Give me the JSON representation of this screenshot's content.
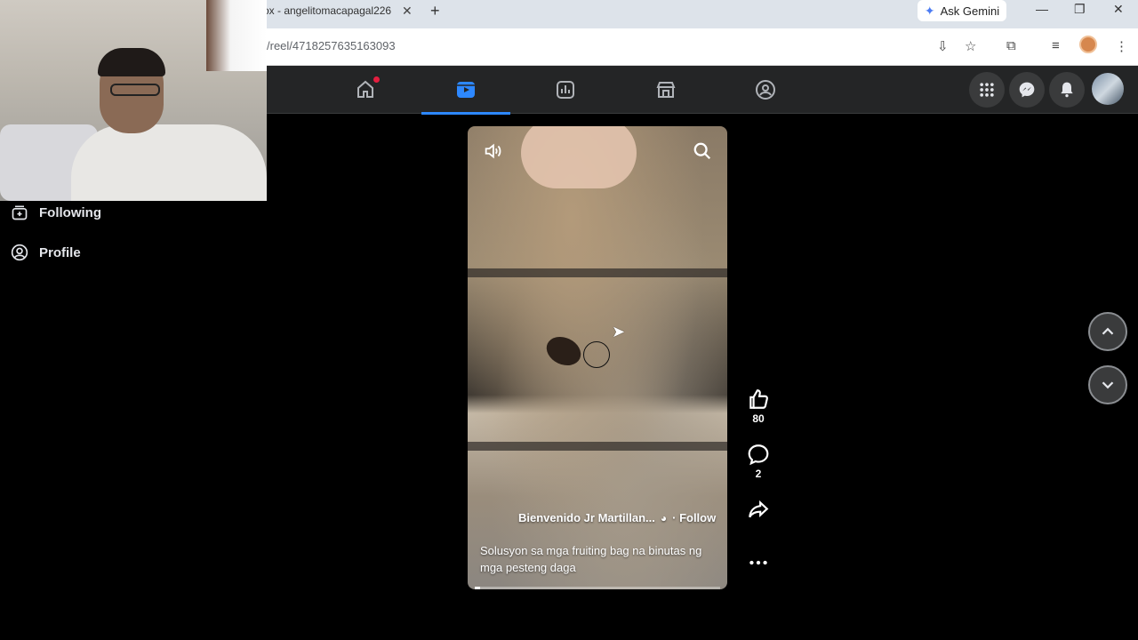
{
  "browser": {
    "tab_title": "ox - angelitomacapagal226",
    "url": "/reel/4718257635163093",
    "ask_gemini_label": "Ask Gemini"
  },
  "fb_nav": {
    "tabs": [
      {
        "name": "home-icon",
        "active": false,
        "badge": true
      },
      {
        "name": "reels-icon",
        "active": true,
        "badge": false
      },
      {
        "name": "dashboard-icon",
        "active": false,
        "badge": false
      },
      {
        "name": "marketplace-icon",
        "active": false,
        "badge": false
      },
      {
        "name": "groups-icon",
        "active": false,
        "badge": false
      }
    ]
  },
  "sidebar": {
    "items": [
      {
        "label": "Following",
        "icon": "following-icon"
      },
      {
        "label": "Profile",
        "icon": "profile-icon"
      }
    ]
  },
  "reel": {
    "author": "Bienvenido Jr Martillan...",
    "follow_label": "· Follow",
    "caption": "Solusyon sa mga fruiting bag na binutas ng mga pesteng daga",
    "progress": 0.02
  },
  "actions": {
    "likes": "80",
    "comments": "2"
  },
  "colors": {
    "accent": "#2d88ff",
    "nav_bg": "#242526",
    "badge": "#e41e3f"
  }
}
